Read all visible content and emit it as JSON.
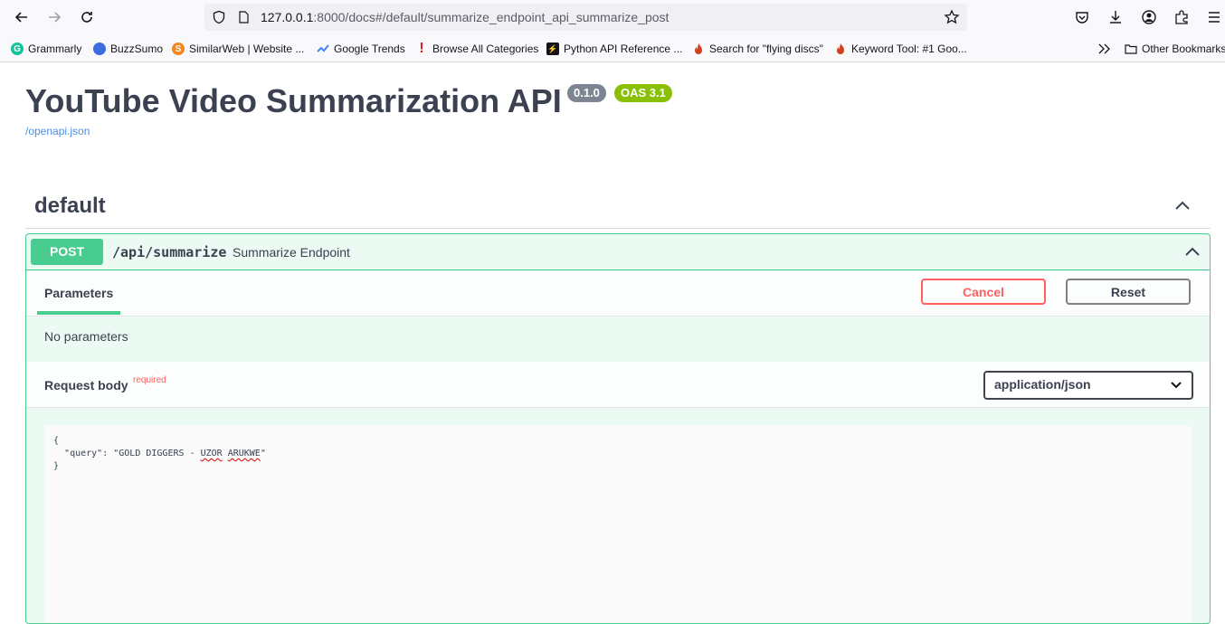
{
  "browser": {
    "url_host": "127.0.0.1",
    "url_rest": ":8000/docs#/default/summarize_endpoint_api_summarize_post",
    "bookmarks": [
      {
        "label": "Grammarly",
        "icon": "grammarly-icon",
        "color": "#15c39a",
        "glyph": "G"
      },
      {
        "label": "BuzzSumo",
        "icon": "buzzsumo-icon",
        "color": "#3c6ddf",
        "glyph": ""
      },
      {
        "label": "SimilarWeb | Website ...",
        "icon": "similarweb-icon",
        "color": "#f5851f",
        "glyph": "S"
      },
      {
        "label": "Google Trends",
        "icon": "google-trends-icon",
        "color": "#4285f4",
        "glyph": ""
      },
      {
        "label": "Browse All Categories",
        "icon": "exclamation-icon",
        "color": "#e11b22",
        "glyph": "!"
      },
      {
        "label": "Python API Reference ...",
        "icon": "bolt-icon",
        "color": "#15141a",
        "glyph": "⚡"
      },
      {
        "label": "Search for \"flying discs\"",
        "icon": "flame-icon",
        "color": "#d1411e",
        "glyph": ""
      },
      {
        "label": "Keyword Tool: #1 Goo...",
        "icon": "flame-icon",
        "color": "#d1411e",
        "glyph": ""
      }
    ],
    "other_bookmarks": "Other Bookmarks"
  },
  "page": {
    "title": "YouTube Video Summarization API",
    "version": "0.1.0",
    "oas": "OAS 3.1",
    "openapi_link": "/openapi.json",
    "tag": "default"
  },
  "operation": {
    "method": "POST",
    "path": "/api/summarize",
    "description": "Summarize Endpoint",
    "parameters_tab": "Parameters",
    "cancel_label": "Cancel",
    "reset_label": "Reset",
    "no_parameters": "No parameters",
    "request_body_label": "Request body",
    "required_label": "required",
    "content_type": "application/json",
    "body_open": "{",
    "body_key": "\"query\": ",
    "body_value_prefix": "\"GOLD DIGGERS - ",
    "body_value_word1": "UZOR",
    "body_value_word2": "ARUKWE",
    "body_value_suffix": "\"",
    "body_close": "}"
  },
  "colors": {
    "post_green": "#49cc90",
    "cancel_red": "#ff6060",
    "version_badge": "#7d8492",
    "oas_badge": "#89bf04",
    "link_blue": "#4990e2"
  }
}
